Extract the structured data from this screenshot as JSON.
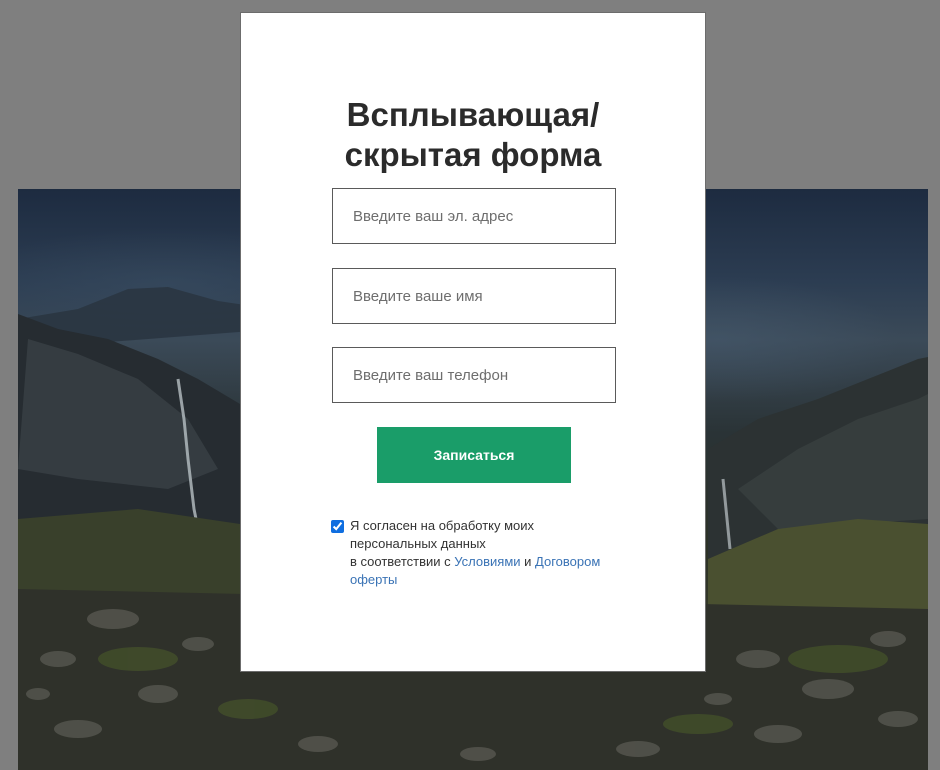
{
  "form": {
    "title_line1": "Всплывающая/",
    "title_line2": "скрытая форма",
    "email_placeholder": "Введите ваш эл. адрес",
    "name_placeholder": "Введите ваше имя",
    "phone_placeholder": "Введите ваш телефон",
    "submit_label": "Записаться",
    "consent": {
      "checked": true,
      "text_line1": "Я согласен на обработку моих персональных данных",
      "text_line2_prefix": "в соответствии с ",
      "terms_link": "Условиями",
      "conjunction": " и ",
      "offer_link": "Договором оферты"
    }
  },
  "colors": {
    "overlay": "#7f7f7f",
    "submit_bg": "#1a9d69",
    "link": "#3a73b5",
    "title": "#2b2b2b"
  }
}
